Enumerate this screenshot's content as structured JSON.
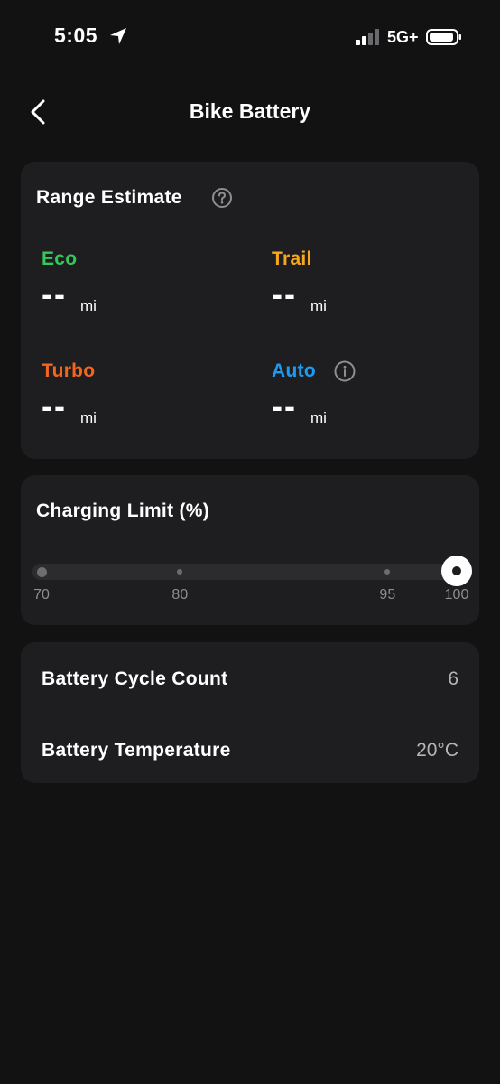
{
  "status_bar": {
    "time": "5:05",
    "network": "5G+",
    "battery_level": 0.9,
    "signal_bars": 2
  },
  "nav": {
    "title": "Bike Battery"
  },
  "range_estimate": {
    "title": "Range Estimate",
    "modes": [
      {
        "name": "Eco",
        "value": "--",
        "unit": "mi",
        "color": "#34c759"
      },
      {
        "name": "Trail",
        "value": "--",
        "unit": "mi",
        "color": "#f5a623"
      },
      {
        "name": "Turbo",
        "value": "--",
        "unit": "mi",
        "color": "#f2661f"
      },
      {
        "name": "Auto",
        "value": "--",
        "unit": "mi",
        "color": "#1e9bf0"
      }
    ]
  },
  "charging_limit": {
    "title": "Charging Limit (%)",
    "options": [
      "70",
      "80",
      "95",
      "100"
    ],
    "selected": "100"
  },
  "battery_info": {
    "rows": [
      {
        "label": "Battery Cycle Count",
        "value": "6"
      },
      {
        "label": "Battery Temperature",
        "value": "20°C"
      }
    ]
  },
  "colors": {
    "background": "#121212",
    "card": "#1e1e21",
    "secondary_text": "#8e8e92"
  }
}
